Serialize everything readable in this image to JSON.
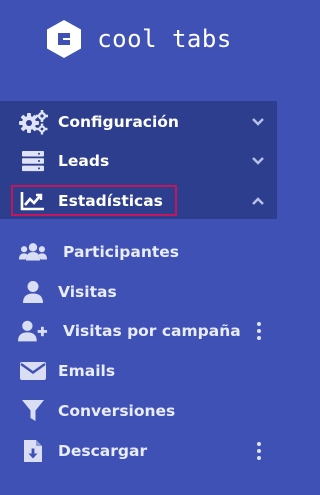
{
  "brand": {
    "name_left": "cool",
    "name_right": "tabs",
    "logo_icon": "cooltabs-hexagon-logo"
  },
  "colors": {
    "sidebar_bg": "#3f51b5",
    "upper_band_bg": "#2e3e8e",
    "active_outline": "#c2185b"
  },
  "menu": {
    "main": [
      {
        "label": "Configuración",
        "icon": "gears-icon",
        "expander": "chevron-down"
      },
      {
        "label": "Leads",
        "icon": "server-stack-icon",
        "expander": "chevron-down"
      },
      {
        "label": "Estadísticas",
        "icon": "line-chart-icon",
        "expander": "chevron-up",
        "active": true
      }
    ],
    "submenu": [
      {
        "label": "Participantes",
        "icon": "users-group-icon"
      },
      {
        "label": "Visitas",
        "icon": "user-icon"
      },
      {
        "label": "Visitas por campaña",
        "icon": "user-plus-icon",
        "more": "kebab-menu-icon"
      },
      {
        "label": "Emails",
        "icon": "envelope-icon"
      },
      {
        "label": "Conversiones",
        "icon": "funnel-filter-icon"
      },
      {
        "label": "Descargar",
        "icon": "file-download-icon",
        "more": "kebab-menu-icon"
      }
    ]
  }
}
